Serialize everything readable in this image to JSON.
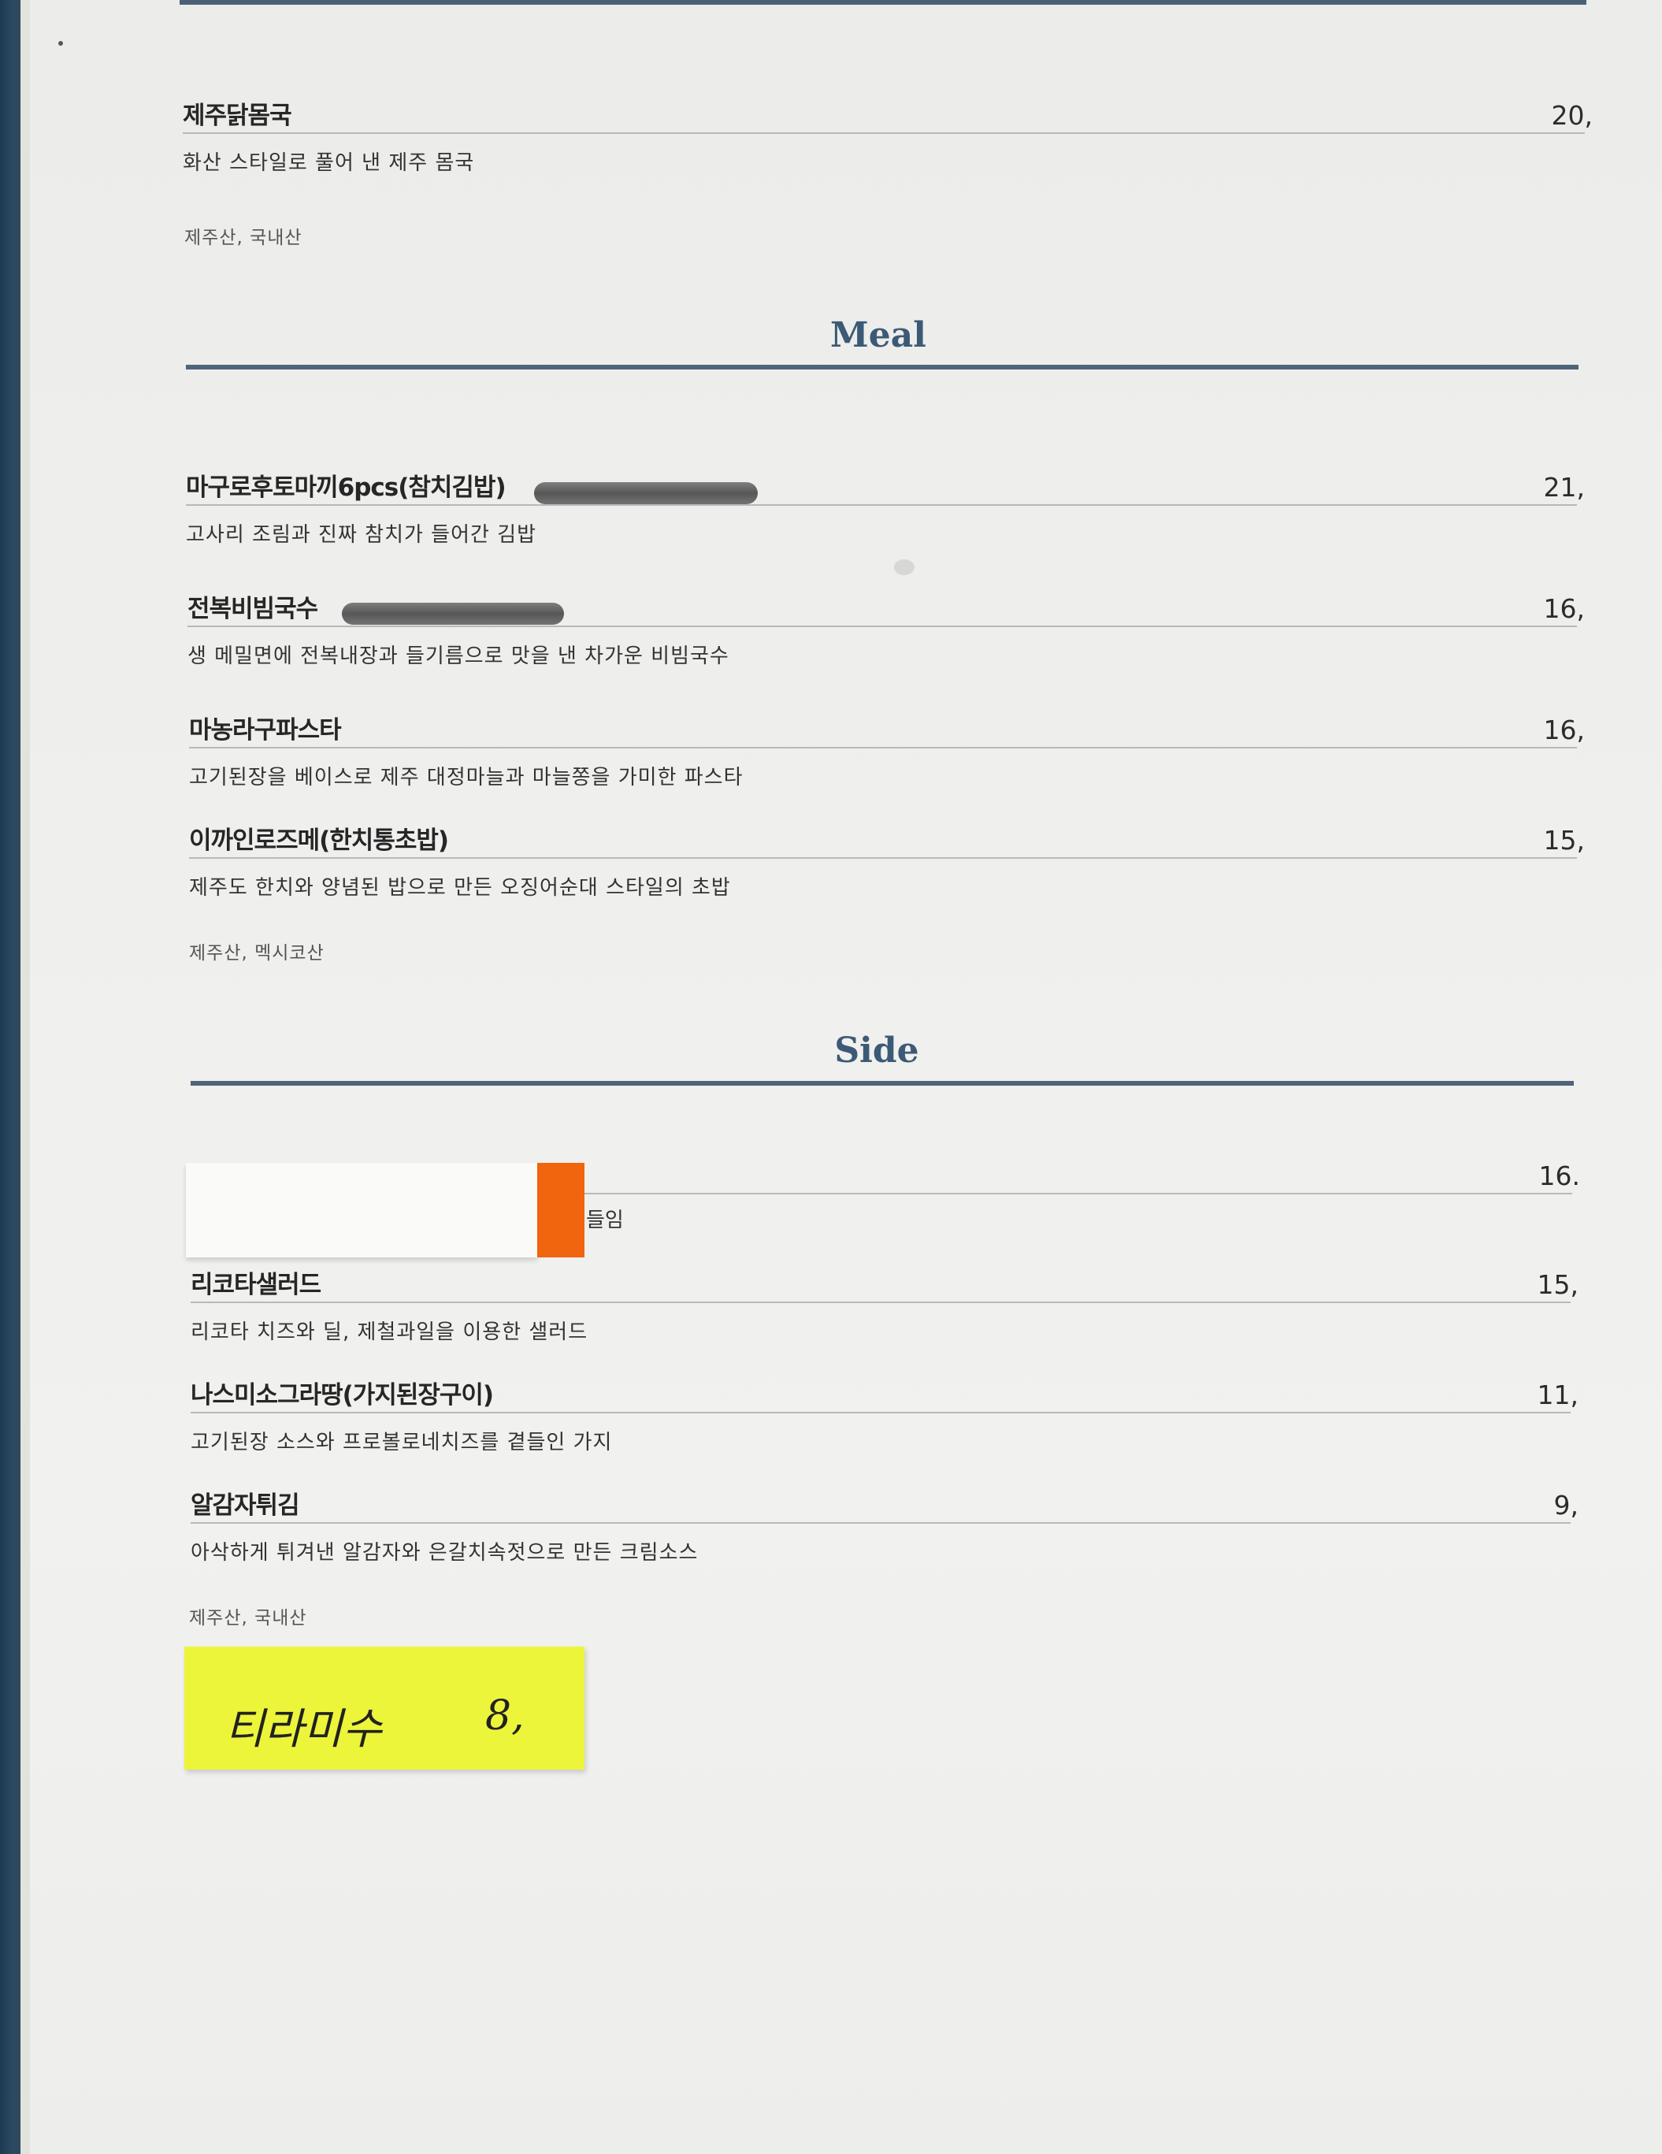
{
  "top_item": {
    "name": "제주닭몸국",
    "price": "20,",
    "description": "화산 스타일로 풀어 낸 제주 몸국",
    "origin": "제주산, 국내산"
  },
  "meal": {
    "title": "Meal",
    "items": [
      {
        "name": "마구로후토마끼6pcs(참치김밥)",
        "price": "21,",
        "description": "고사리 조림과 진짜 참치가 들어간 김밥"
      },
      {
        "name": "전복비빔국수",
        "price": "16,",
        "description": "생 메밀면에 전복내장과 들기름으로 맛을 낸 차가운 비빔국수"
      },
      {
        "name": "마농라구파스타",
        "price": "16,",
        "description": "고기된장을 베이스로 제주 대정마늘과 마늘쫑을 가미한 파스타"
      },
      {
        "name": "이까인로즈메(한치통초밥)",
        "price": "15,",
        "description": "제주도 한치와 양념된 밥으로 만든 오징어순대 스타일의 초밥"
      }
    ],
    "origin": "제주산, 멕시코산"
  },
  "side": {
    "title": "Side",
    "covered_item": {
      "price": "16.",
      "description_tail": "들임"
    },
    "items": [
      {
        "name": "리코타샐러드",
        "price": "15,",
        "description": "리코타 치즈와 딜, 제철과일을 이용한 샐러드"
      },
      {
        "name": "나스미소그라땅(가지된장구이)",
        "price": "11,",
        "description": "고기된장 소스와 프로볼로네치즈를 곁들인 가지"
      },
      {
        "name": "알감자튀김",
        "price": "9,",
        "description": "아삭하게 튀겨낸 알감자와 은갈치속젓으로 만든 크림소스"
      }
    ],
    "origin": "제주산, 국내산"
  },
  "sticky_note": {
    "name": "티라미수",
    "price": "8,",
    "color": "#ecf53a"
  },
  "colors": {
    "section_title": "#3c5a76",
    "section_rule": "#4e647b",
    "cover_orange": "#f0650e"
  }
}
